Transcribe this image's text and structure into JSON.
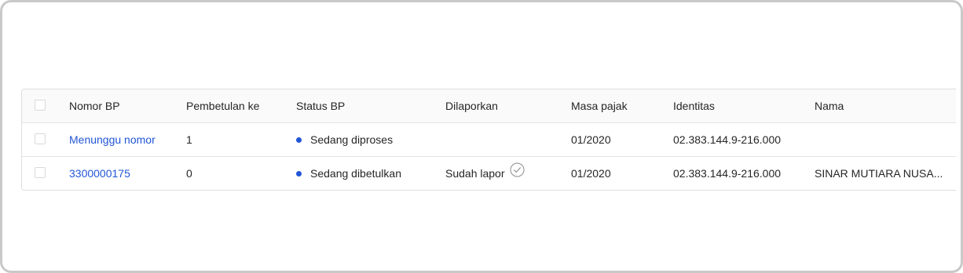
{
  "table": {
    "columns": [
      "Nomor BP",
      "Pembetulan ke",
      "Status BP",
      "Dilaporkan",
      "Masa pajak",
      "Identitas",
      "Nama"
    ],
    "rows": [
      {
        "nomor_bp": "Menunggu nomor",
        "pembetulan_ke": "1",
        "status_bp": "Sedang diproses",
        "status_color": "#2156d6",
        "dilaporkan": "",
        "masa_pajak": "01/2020",
        "identitas": "02.383.144.9-216.000",
        "nama": ""
      },
      {
        "nomor_bp": "3300000175",
        "pembetulan_ke": "0",
        "status_bp": "Sedang dibetulkan",
        "status_color": "#2156d6",
        "dilaporkan": "Sudah lapor",
        "dilaporkan_icon": "check-circle-icon",
        "masa_pajak": "01/2020",
        "identitas": "02.383.144.9-216.000",
        "nama": "SINAR MUTIARA NUSA..."
      }
    ]
  },
  "colors": {
    "link": "#2156d6",
    "status_dot": "#2156d6",
    "border": "#dedede",
    "header_bg": "#fafafa"
  }
}
